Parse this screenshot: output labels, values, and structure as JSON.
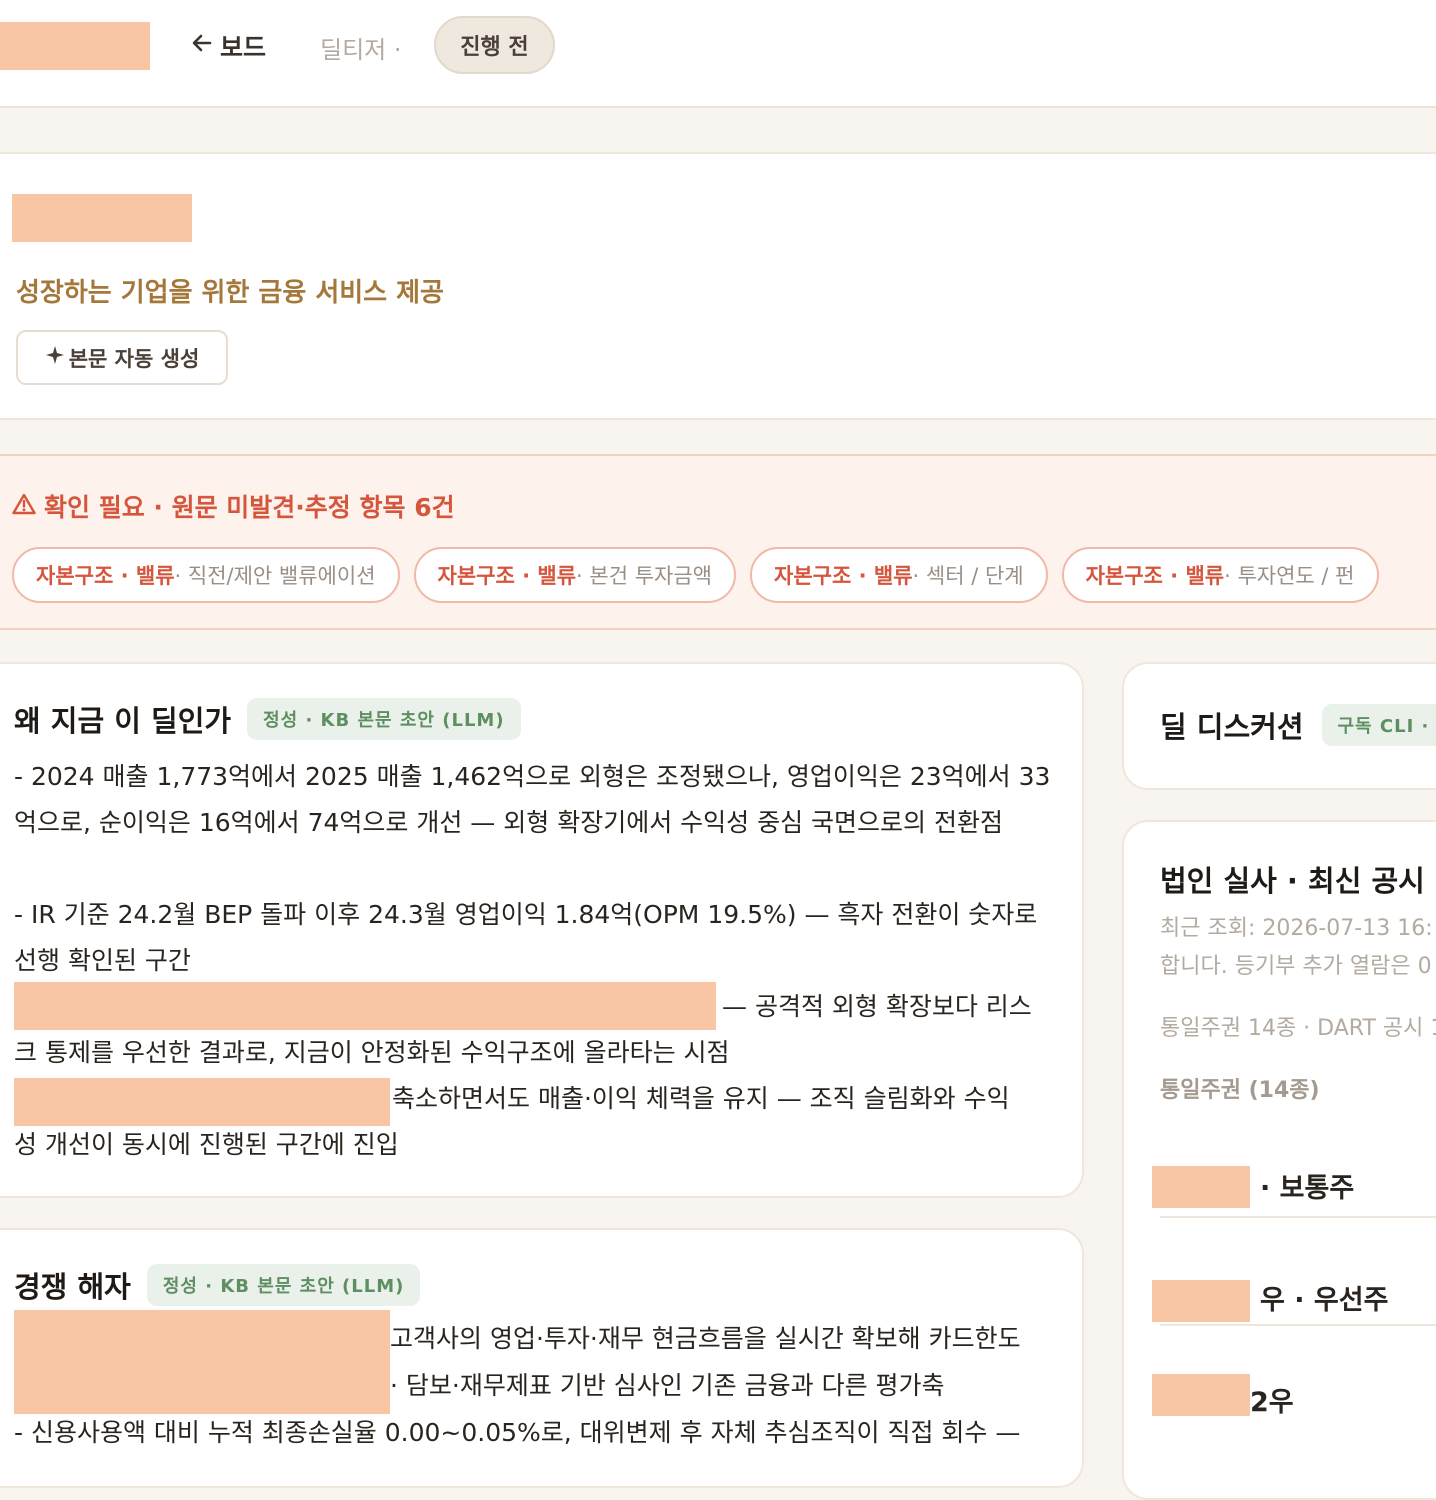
{
  "topbar": {
    "back_label": "보드",
    "crumb": "딜티저 ·",
    "status_pill": "진행 전"
  },
  "hero": {
    "tagline": "성장하는 기업을 위한 금융 서비스 제공",
    "generate_button": "본문 자동 생성"
  },
  "alert": {
    "title": "확인 필요 · 원문 미발견·추정 항목 6건",
    "chips": [
      {
        "key": "자본구조 · 밸류",
        "text": " · 직전/제안 밸류에이션"
      },
      {
        "key": "자본구조 · 밸류",
        "text": " · 본건 투자금액"
      },
      {
        "key": "자본구조 · 밸류",
        "text": " · 섹터 / 단계"
      },
      {
        "key": "자본구조 · 밸류",
        "text": " · 투자연도 / 펀"
      }
    ]
  },
  "why": {
    "title": "왜 지금 이 딜인가",
    "badge": "정성 · KB 본문 초안 (LLM)",
    "p1": "- 2024 매출 1,773억에서 2025 매출 1,462억으로 외형은 조정됐으나, 영업이익은 23억에서 33억으로, 순이익은 16억에서 74억으로 개선 — 외형 확장기에서 수익성 중심 국면으로의 전환점",
    "p2": "- IR 기준 24.2월 BEP 돌파 이후 24.3월 영업이익 1.84억(OPM 19.5%) — 흑자 전환이 숫자로 선행 확인된 구간",
    "p3a": "— 공격적 외형 확장보다 리스",
    "p3b": "크 통제를 우선한 결과로, 지금이 안정화된 수익구조에 올라타는 시점",
    "p4a": "축소하면서도 매출·이익 체력을 유지 — 조직 슬림화와 수익",
    "p4b": "성 개선이 동시에 진행된 구간에 진입"
  },
  "competition": {
    "title": "경쟁 해자",
    "badge": "정성 · KB 본문 초안 (LLM)",
    "l1": "고객사의 영업·투자·재무 현금흐름을 실시간 확보해 카드한도",
    "l2": "· 담보·재무제표 기반 심사인 기존 금융과 다른 평가축",
    "l3": "- 신용사용액 대비 누적 최종손실율 0.00~0.05%로, 대위변제 후 자체 추심조직이 직접 회수 —"
  },
  "discussion": {
    "title": "딜 디스커션",
    "badge": "구독 CLI · "
  },
  "corporate": {
    "title": "법인 실사 · 최신 공시",
    "recent": "최근 조회: 2026-07-13 16:",
    "note": "합니다. 등기부 추가 열람은 0",
    "summary": "통일주권 14종 · DART 공시 1",
    "subhead": "통일주권 (14종)",
    "stocks": [
      "· 보통주",
      "우 · 우선주",
      "2우"
    ]
  }
}
